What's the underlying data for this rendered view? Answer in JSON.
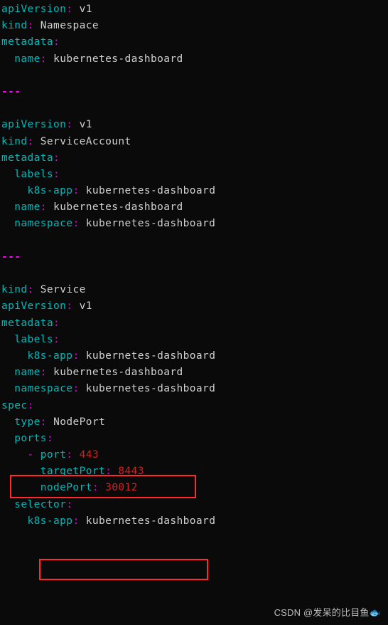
{
  "watermark": "CSDN @发呆的比目鱼🐟",
  "lines": [
    [
      [
        "key",
        "apiVersion"
      ],
      [
        "col",
        ":"
      ],
      [
        "val",
        " v1"
      ]
    ],
    [
      [
        "key",
        "kind"
      ],
      [
        "col",
        ":"
      ],
      [
        "val",
        " Namespace"
      ]
    ],
    [
      [
        "key",
        "metadata"
      ],
      [
        "col",
        ":"
      ]
    ],
    [
      [
        "val",
        "  "
      ],
      [
        "key",
        "name"
      ],
      [
        "col",
        ":"
      ],
      [
        "val",
        " kubernetes-dashboard"
      ]
    ],
    [],
    [
      [
        "sep",
        "---"
      ]
    ],
    [],
    [
      [
        "key",
        "apiVersion"
      ],
      [
        "col",
        ":"
      ],
      [
        "val",
        " v1"
      ]
    ],
    [
      [
        "key",
        "kind"
      ],
      [
        "col",
        ":"
      ],
      [
        "val",
        " ServiceAccount"
      ]
    ],
    [
      [
        "key",
        "metadata"
      ],
      [
        "col",
        ":"
      ]
    ],
    [
      [
        "val",
        "  "
      ],
      [
        "key",
        "labels"
      ],
      [
        "col",
        ":"
      ]
    ],
    [
      [
        "val",
        "    "
      ],
      [
        "key",
        "k8s-app"
      ],
      [
        "col",
        ":"
      ],
      [
        "val",
        " kubernetes-dashboard"
      ]
    ],
    [
      [
        "val",
        "  "
      ],
      [
        "key",
        "name"
      ],
      [
        "col",
        ":"
      ],
      [
        "val",
        " kubernetes-dashboard"
      ]
    ],
    [
      [
        "val",
        "  "
      ],
      [
        "key",
        "namespace"
      ],
      [
        "col",
        ":"
      ],
      [
        "val",
        " kubernetes-dashboard"
      ]
    ],
    [],
    [
      [
        "sep",
        "---"
      ]
    ],
    [],
    [
      [
        "key",
        "kind"
      ],
      [
        "col",
        ":"
      ],
      [
        "val",
        " Service"
      ]
    ],
    [
      [
        "key",
        "apiVersion"
      ],
      [
        "col",
        ":"
      ],
      [
        "val",
        " v1"
      ]
    ],
    [
      [
        "key",
        "metadata"
      ],
      [
        "col",
        ":"
      ]
    ],
    [
      [
        "val",
        "  "
      ],
      [
        "key",
        "labels"
      ],
      [
        "col",
        ":"
      ]
    ],
    [
      [
        "val",
        "    "
      ],
      [
        "key",
        "k8s-app"
      ],
      [
        "col",
        ":"
      ],
      [
        "val",
        " kubernetes-dashboard"
      ]
    ],
    [
      [
        "val",
        "  "
      ],
      [
        "key",
        "name"
      ],
      [
        "col",
        ":"
      ],
      [
        "val",
        " kubernetes-dashboard"
      ]
    ],
    [
      [
        "val",
        "  "
      ],
      [
        "key",
        "namespace"
      ],
      [
        "col",
        ":"
      ],
      [
        "val",
        " kubernetes-dashboard"
      ]
    ],
    [
      [
        "key",
        "spec"
      ],
      [
        "col",
        ":"
      ]
    ],
    [
      [
        "val",
        "  "
      ],
      [
        "key",
        "type"
      ],
      [
        "col",
        ":"
      ],
      [
        "val",
        " NodePort"
      ]
    ],
    [
      [
        "val",
        "  "
      ],
      [
        "key",
        "ports"
      ],
      [
        "col",
        ":"
      ]
    ],
    [
      [
        "val",
        "    "
      ],
      [
        "dash",
        "- "
      ],
      [
        "key",
        "port"
      ],
      [
        "col",
        ":"
      ],
      [
        "val",
        " "
      ],
      [
        "num",
        "443"
      ]
    ],
    [
      [
        "val",
        "      "
      ],
      [
        "key",
        "targetPort"
      ],
      [
        "col",
        ":"
      ],
      [
        "val",
        " "
      ],
      [
        "num",
        "8443"
      ]
    ],
    [
      [
        "val",
        "      "
      ],
      [
        "key",
        "nodePort"
      ],
      [
        "col",
        ":"
      ],
      [
        "val",
        " "
      ],
      [
        "num",
        "30012"
      ]
    ],
    [
      [
        "val",
        "  "
      ],
      [
        "key",
        "selector"
      ],
      [
        "col",
        ":"
      ]
    ],
    [
      [
        "val",
        "    "
      ],
      [
        "key",
        "k8s-app"
      ],
      [
        "col",
        ":"
      ],
      [
        "val",
        " kubernetes-dashboard"
      ]
    ],
    []
  ]
}
